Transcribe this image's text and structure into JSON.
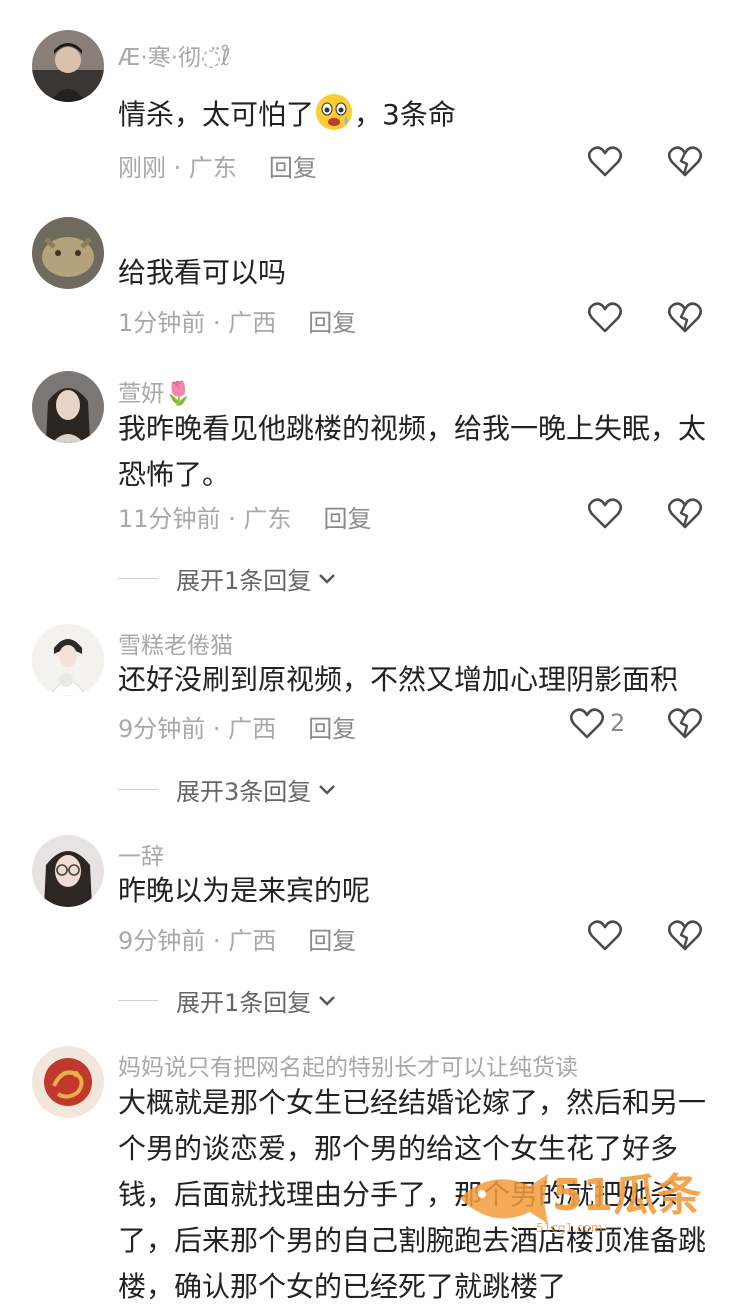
{
  "comments": [
    {
      "username": "Æ·寒·彻◌̈ℓ̊",
      "text_before": "情杀，太可怕了",
      "text_after": "，3条命",
      "emoji": "fearful-face-emoji",
      "time": "刚刚",
      "region": "广东",
      "reply": "回复"
    },
    {
      "username": "",
      "text": "给我看可以吗",
      "time": "1分钟前",
      "region": "广西",
      "reply": "回复"
    },
    {
      "username": "萱妍🌷",
      "text": "我昨晚看见他跳楼的视频，给我一晚上失眠，太恐怖了。",
      "time": "11分钟前",
      "region": "广东",
      "reply": "回复",
      "expand": "展开1条回复"
    },
    {
      "username": "雪糕老倦猫",
      "text": "还好没刷到原视频，不然又增加心理阴影面积",
      "time": "9分钟前",
      "region": "广西",
      "reply": "回复",
      "likes": "2",
      "expand": "展开3条回复"
    },
    {
      "username": "一辞",
      "text": "昨晚以为是来宾的呢",
      "time": "9分钟前",
      "region": "广西",
      "reply": "回复",
      "expand": "展开1条回复"
    },
    {
      "username": "妈妈说只有把网名起的特别长才可以让纯货读",
      "text": "大概就是那个女生已经结婚论嫁了，然后和另一个男的谈恋爱，那个男的给这个女生花了好多钱，后面就找理由分手了，那个男的就把她杀了，后来那个男的自己割腕跑去酒店楼顶准备跳楼，确认那个女的已经死了就跳楼了"
    }
  ],
  "separator": "·",
  "watermark": {
    "logo": "51瓜条",
    "url": "51cg1.com"
  },
  "colors": {
    "text": "#222222",
    "meta": "#a8a8a8",
    "icon": "#4a4a4a",
    "watermark": "#f39c3d"
  }
}
